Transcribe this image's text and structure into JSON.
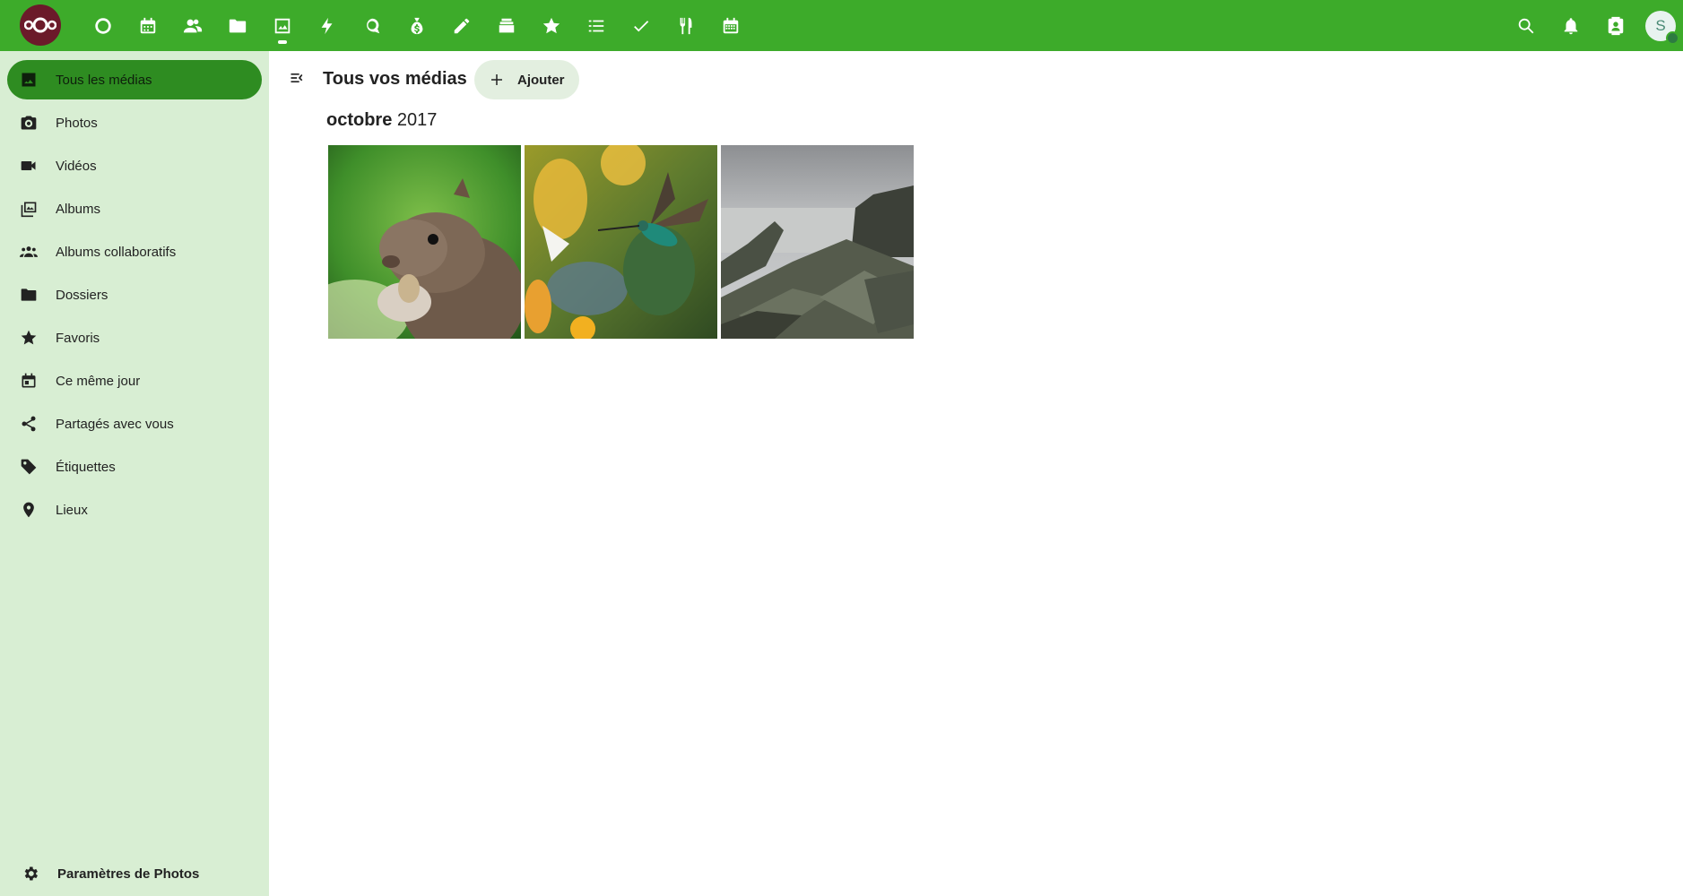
{
  "header": {
    "apps": [
      {
        "name": "dashboard-icon"
      },
      {
        "name": "calendar-icon"
      },
      {
        "name": "contacts-icon"
      },
      {
        "name": "files-icon"
      },
      {
        "name": "photos-icon",
        "active": true
      },
      {
        "name": "activity-icon"
      },
      {
        "name": "talk-icon"
      },
      {
        "name": "cospend-icon"
      },
      {
        "name": "notes-icon"
      },
      {
        "name": "deck-icon"
      },
      {
        "name": "bookmarks-icon"
      },
      {
        "name": "tasks-list-icon"
      },
      {
        "name": "tasks-icon"
      },
      {
        "name": "cookbook-icon"
      },
      {
        "name": "calendar-grid-icon"
      }
    ],
    "avatar_initial": "S"
  },
  "sidebar": {
    "items": [
      {
        "label": "Tous les médias",
        "icon": "image-icon",
        "active": true
      },
      {
        "label": "Photos",
        "icon": "camera-icon"
      },
      {
        "label": "Vidéos",
        "icon": "video-icon"
      },
      {
        "label": "Albums",
        "icon": "albums-icon"
      },
      {
        "label": "Albums collaboratifs",
        "icon": "group-icon"
      },
      {
        "label": "Dossiers",
        "icon": "folder-icon"
      },
      {
        "label": "Favoris",
        "icon": "star-icon"
      },
      {
        "label": "Ce même jour",
        "icon": "calendar-today-icon"
      },
      {
        "label": "Partagés avec vous",
        "icon": "share-icon"
      },
      {
        "label": "Étiquettes",
        "icon": "tag-icon"
      },
      {
        "label": "Lieux",
        "icon": "location-icon"
      }
    ],
    "settings_label": "Paramètres de Photos"
  },
  "main": {
    "title": "Tous vos médias",
    "add_label": "Ajouter",
    "section_month": "octobre",
    "section_year": "2017",
    "photos": [
      {
        "subject": "squirrel"
      },
      {
        "subject": "hummingbird"
      },
      {
        "subject": "rocky-shore"
      }
    ]
  },
  "colors": {
    "header": "#3dab2a",
    "sidebar": "#d8eed3",
    "active_item": "#2e8c21"
  }
}
